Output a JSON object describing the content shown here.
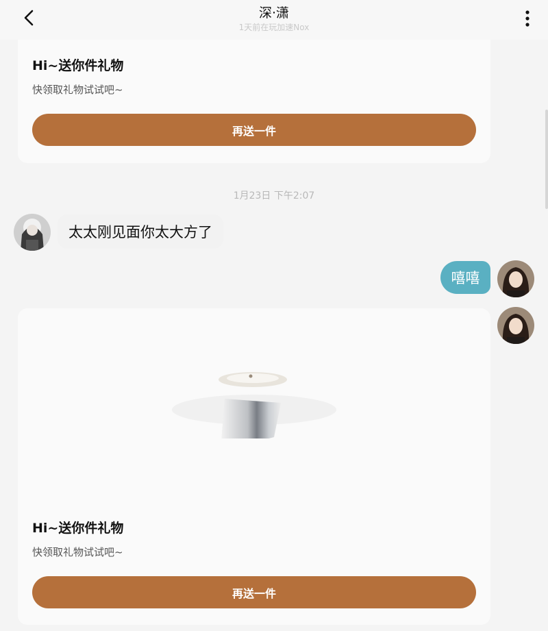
{
  "header": {
    "title": "深·潇",
    "subtitle": "1天前在玩加速Nox"
  },
  "icons": {
    "back": "chevron-left-icon",
    "more": "vertical-dots-icon"
  },
  "messages": {
    "gift_card_top": {
      "title": "Hi~送你件礼物",
      "description": "快领取礼物试试吧~",
      "button_label": "再送一件"
    },
    "timestamp": "1月23日 下午2:07",
    "incoming_text": "太太刚见面你太大方了",
    "outgoing_text": "嘻嘻",
    "gift_card_bottom": {
      "title": "Hi~送你件礼物",
      "description": "快领取礼物试试吧~",
      "button_label": "再送一件"
    }
  },
  "colors": {
    "gift_button": "#b5703b",
    "outgoing_bubble": "#5ab0c2",
    "background": "#f4f4f4"
  }
}
